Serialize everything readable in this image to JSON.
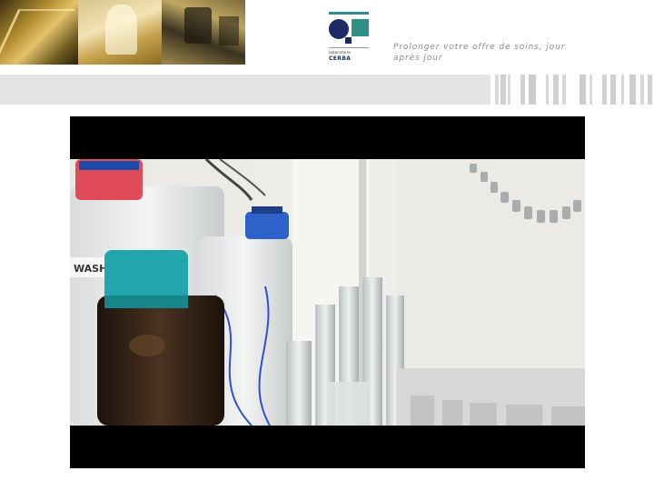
{
  "header": {
    "photos": [
      "lab-photo-1",
      "lab-photo-2",
      "lab-photo-3"
    ],
    "logo": {
      "subtitle": "laboratoire",
      "name": "CERBA"
    },
    "tagline": "Prolonger votre offre de soins, jour après jour"
  },
  "video": {
    "content": "laboratory bottles and test tubes"
  },
  "colors": {
    "brand_teal": "#2f8e86",
    "brand_navy": "#1e2a63",
    "band_grey": "#e4e4e4",
    "tagline_grey": "#8a8a8a"
  }
}
